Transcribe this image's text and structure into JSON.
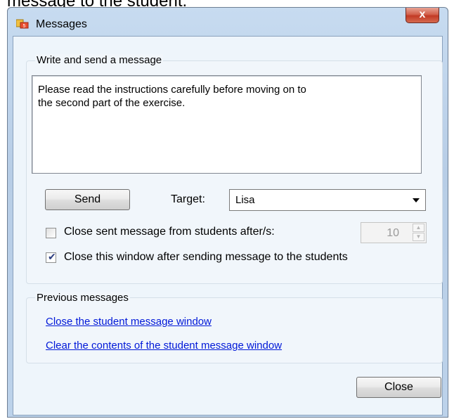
{
  "doc_snippet": "message to the student.",
  "window": {
    "title": "Messages",
    "close_glyph": "x"
  },
  "compose": {
    "group_label": "Write and send a message",
    "message_text": "Please read the instructions carefully before moving on to\nthe second part of the exercise.",
    "send_label": "Send",
    "target_label": "Target:",
    "target_value": "Lisa",
    "auto_close_label": "Close sent message from students after/s:",
    "auto_close_checked": false,
    "auto_close_seconds": "10",
    "close_after_send_label": "Close this window after sending message to the students",
    "close_after_send_checked": true
  },
  "previous": {
    "group_label": "Previous messages",
    "links": [
      "Close the student message window",
      "Clear the contents of the student message window"
    ]
  },
  "footer": {
    "close_label": "Close"
  },
  "icons": {
    "app": "messages-app-icon",
    "dropdown": "chevron-down-icon",
    "check": "checkmark-icon",
    "spin_up": "spin-up-icon",
    "spin_down": "spin-down-icon"
  }
}
